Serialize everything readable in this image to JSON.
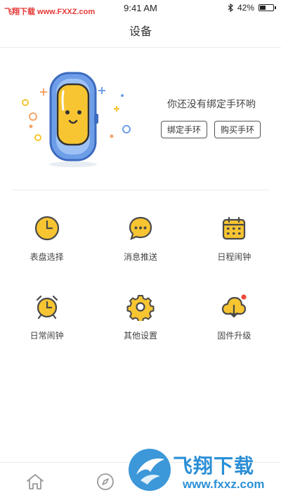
{
  "status_bar": {
    "watermark": "飞翔下载 www.FXXZ.com",
    "time": "9:41 AM",
    "battery": "42%",
    "battery_level": 0.42
  },
  "nav": {
    "title": "设备"
  },
  "bind": {
    "message": "你还没有绑定手环哟",
    "bind_button": "绑定手环",
    "buy_button": "购买手环"
  },
  "grid": {
    "items": [
      {
        "label": "表盘选择",
        "icon": "dial-clock-icon"
      },
      {
        "label": "消息推送",
        "icon": "message-bubble-icon"
      },
      {
        "label": "日程闹钟",
        "icon": "calendar-icon"
      },
      {
        "label": "日常闹钟",
        "icon": "alarm-clock-icon"
      },
      {
        "label": "其他设置",
        "icon": "gear-icon"
      },
      {
        "label": "固件升级",
        "icon": "cloud-download-icon"
      }
    ]
  },
  "tab_bar": {
    "items": [
      {
        "icon": "home-icon"
      },
      {
        "icon": "compass-icon"
      }
    ]
  },
  "watermark_bottom": {
    "brand": "飞翔下载",
    "url": "www.fxxz.com"
  },
  "colors": {
    "accent_yellow": "#f7c531",
    "icon_stroke": "#4a4a4a",
    "band_blue": "#6f9ee8",
    "badge_red": "#e84b3c",
    "watermark_red": "#e53935",
    "watermark_blue": "#2b8fd6"
  }
}
